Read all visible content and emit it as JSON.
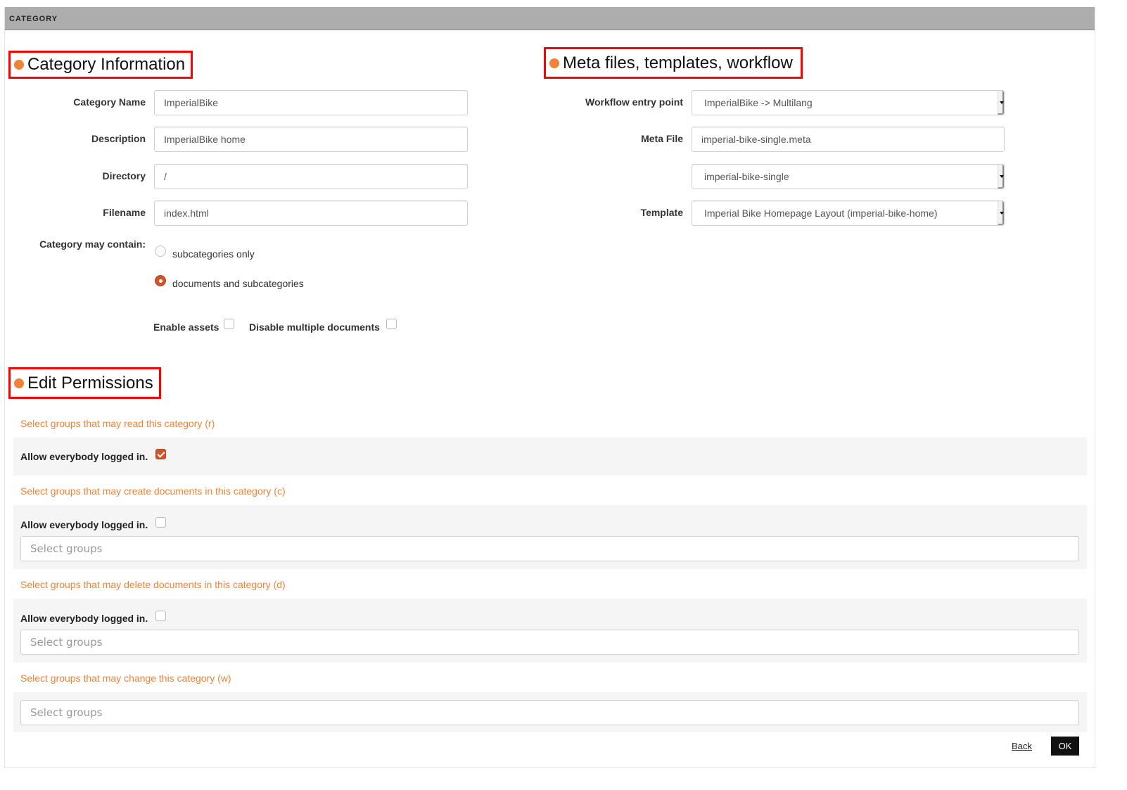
{
  "panel": {
    "title": "CATEGORY"
  },
  "sections": {
    "category_info": "Category Information",
    "meta": "Meta files, templates, workflow",
    "permissions": "Edit Permissions"
  },
  "category_info": {
    "fields": [
      {
        "label": "Category Name",
        "value": "ImperialBike"
      },
      {
        "label": "Description",
        "value": "ImperialBike home"
      },
      {
        "label": "Directory",
        "value": "/"
      },
      {
        "label": "Filename",
        "value": "index.html"
      }
    ],
    "contain_label": "Category may contain:",
    "contain_options": [
      {
        "label": "subcategories only",
        "checked": false
      },
      {
        "label": "documents and subcategories",
        "checked": true
      }
    ],
    "enable_assets": {
      "label": "Enable assets",
      "checked": false
    },
    "disable_multiple": {
      "label": "Disable multiple documents",
      "checked": false
    }
  },
  "meta": {
    "workflow": {
      "label": "Workflow entry point",
      "value": "ImperialBike -> Multilang"
    },
    "meta_file": {
      "label": "Meta File",
      "value": "imperial-bike-single.meta"
    },
    "meta_select": {
      "value": "imperial-bike-single"
    },
    "template": {
      "label": "Template",
      "value": "Imperial Bike Homepage Layout (imperial-bike-home)"
    }
  },
  "permissions": {
    "read": {
      "title": "Select groups that may read this category (r)",
      "allow_label": "Allow everybody logged in.",
      "allow_checked": true
    },
    "create": {
      "title": "Select groups that may create documents in this category (c)",
      "allow_label": "Allow everybody logged in.",
      "allow_checked": false,
      "placeholder": "Select groups"
    },
    "delete": {
      "title": "Select groups that may delete documents in this category (d)",
      "allow_label": "Allow everybody logged in.",
      "allow_checked": false,
      "placeholder": "Select groups"
    },
    "change": {
      "title": "Select groups that may change this category (w)",
      "placeholder": "Select groups"
    }
  },
  "footer": {
    "back_label": "Back",
    "ok_label": "OK"
  },
  "colors": {
    "accent": "#ef8339",
    "checked": "#d2542a",
    "highlight_border": "#ff0000",
    "header_bg": "#adadad"
  }
}
